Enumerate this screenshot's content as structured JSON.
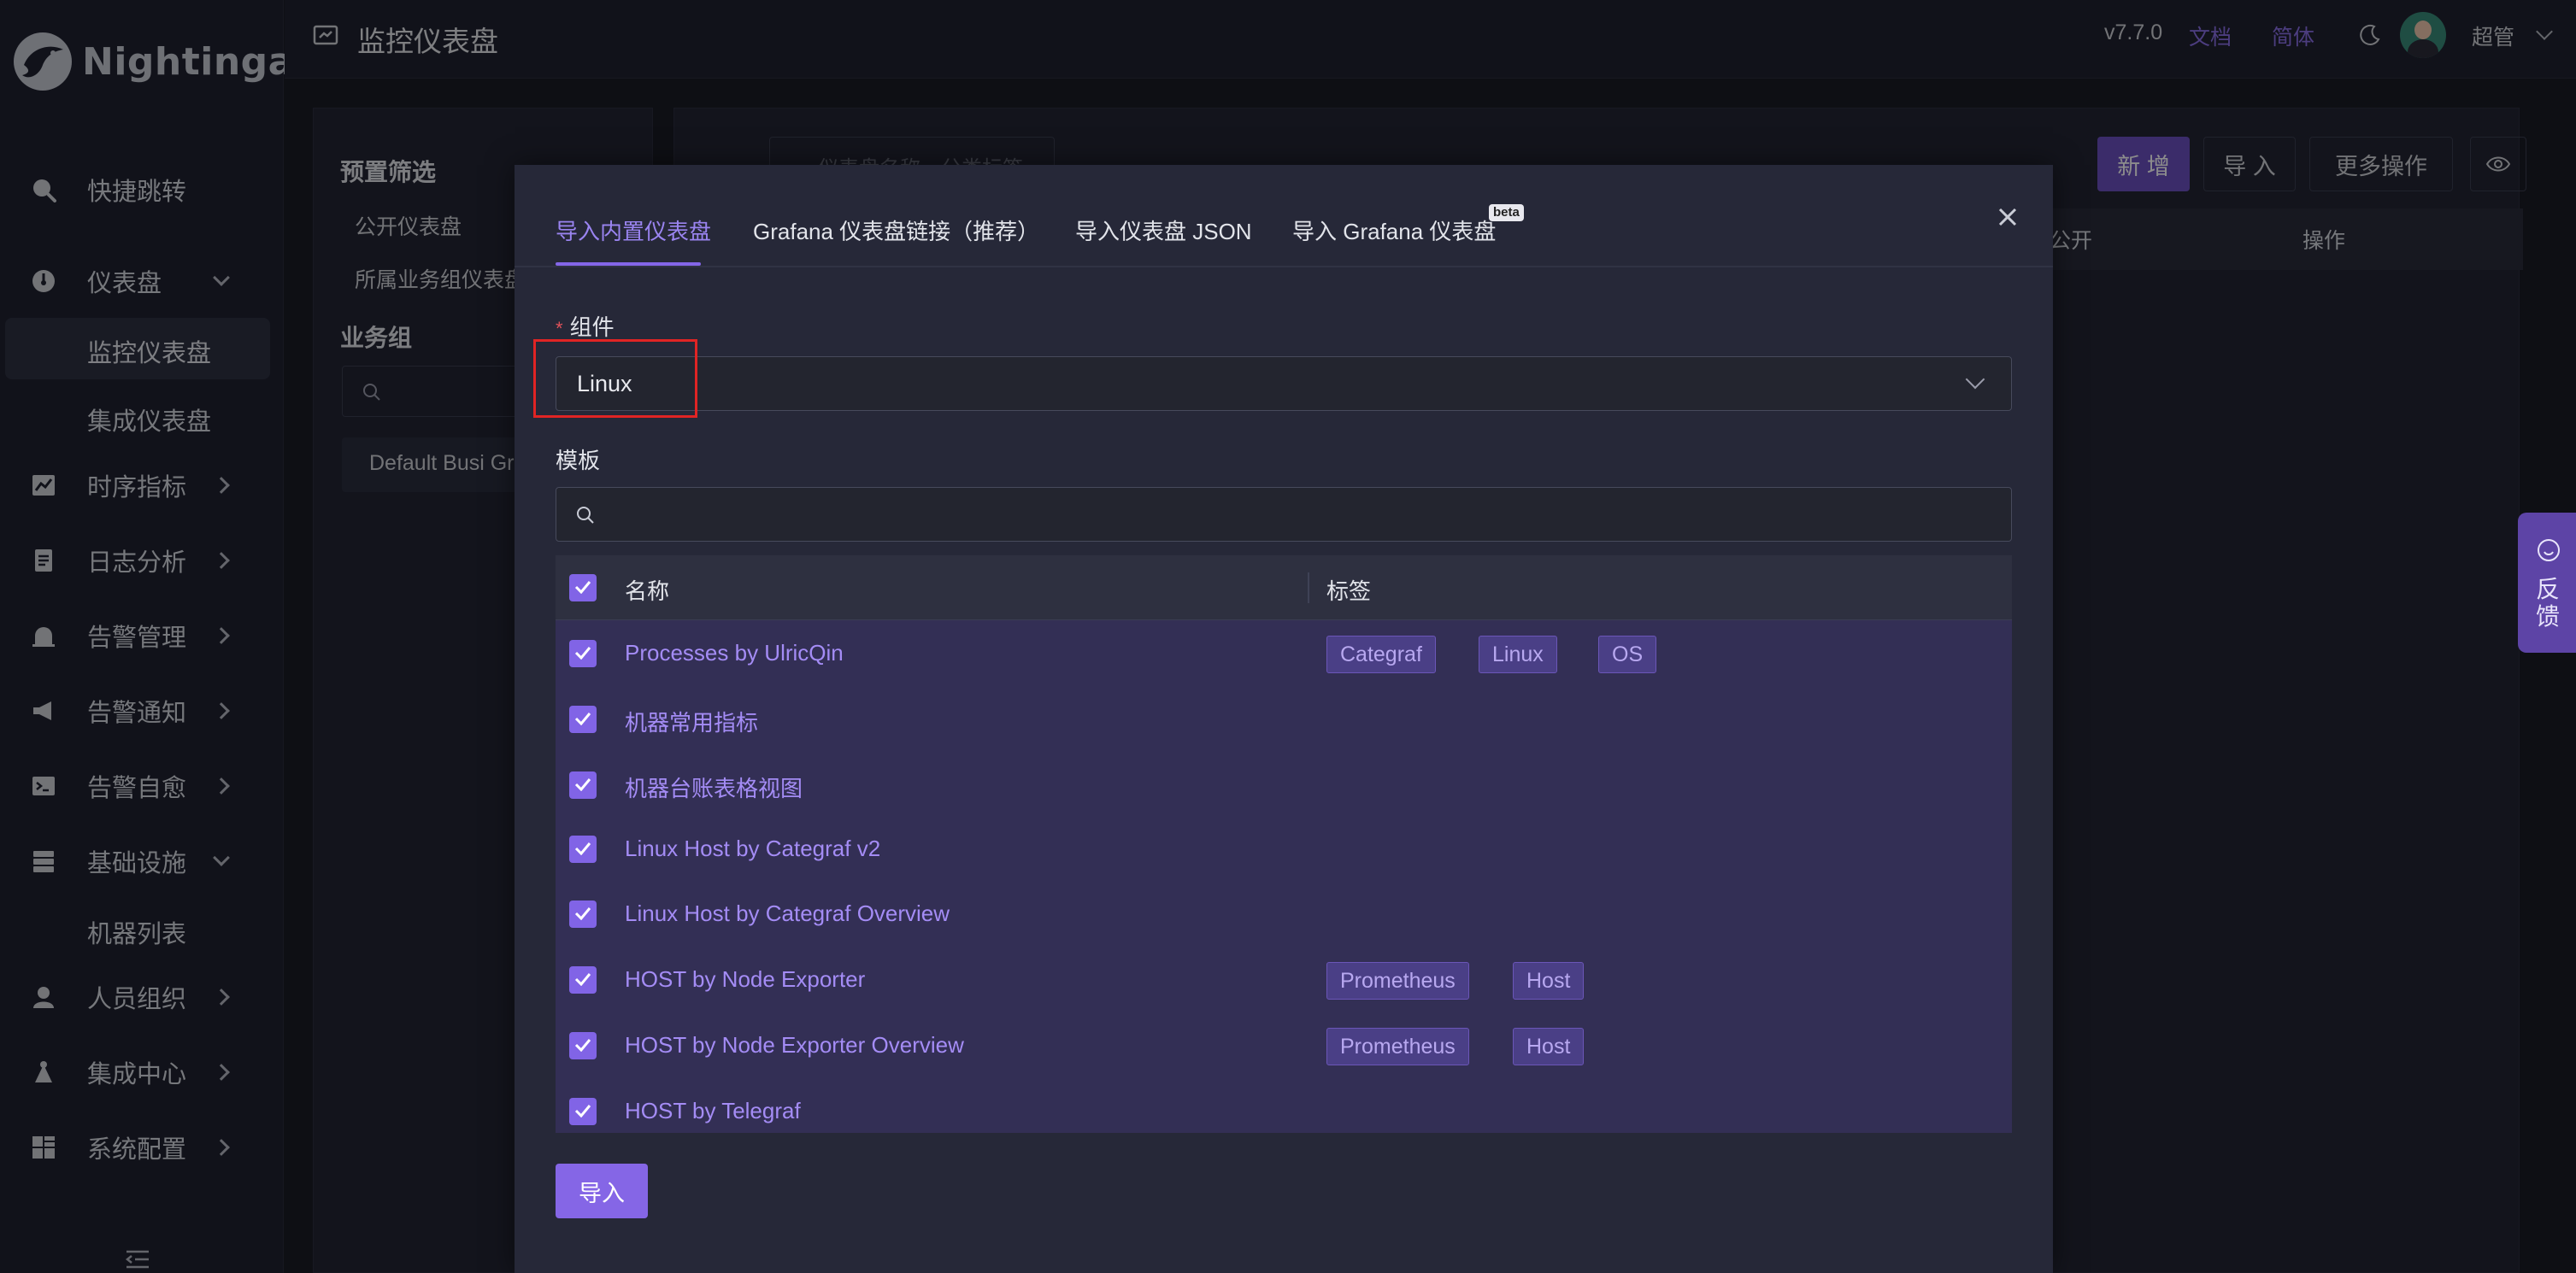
{
  "app": {
    "logo_text": "Nightingale"
  },
  "sidebar": {
    "items": [
      {
        "label": "快捷跳转",
        "icon": "search-icon"
      },
      {
        "label": "仪表盘",
        "icon": "dashboard-icon"
      },
      {
        "label": "时序指标",
        "icon": "line-chart-icon"
      },
      {
        "label": "日志分析",
        "icon": "document-icon"
      },
      {
        "label": "告警管理",
        "icon": "alarm-icon"
      },
      {
        "label": "告警通知",
        "icon": "megaphone-icon"
      },
      {
        "label": "告警自愈",
        "icon": "terminal-icon"
      },
      {
        "label": "基础设施",
        "icon": "database-icon"
      },
      {
        "label": "人员组织",
        "icon": "user-icon"
      },
      {
        "label": "集成中心",
        "icon": "integration-icon"
      },
      {
        "label": "系统配置",
        "icon": "settings-grid-icon"
      }
    ],
    "sub_dashboard": [
      "监控仪表盘",
      "集成仪表盘"
    ],
    "sub_infra": [
      "机器列表"
    ]
  },
  "header": {
    "title": "监控仪表盘",
    "version": "v7.7.0",
    "docs": "文档",
    "lang": "简体",
    "user": "超管"
  },
  "background": {
    "preset_title": "预置筛选",
    "preset_items": [
      "公开仪表盘",
      "所属业务组仪表盘"
    ],
    "bizgroup_title": "业务组",
    "bizgroup_item": "Default Busi Gr",
    "search_placeholder": "仪表盘名称、分类标签",
    "btn_new": "新 增",
    "btn_import": "导 入",
    "btn_more": "更多操作",
    "col_public": "公开",
    "col_ops": "操作"
  },
  "modal": {
    "tabs": [
      "导入内置仪表盘",
      "Grafana 仪表盘链接（推荐）",
      "导入仪表盘 JSON",
      "导入 Grafana 仪表盘"
    ],
    "beta": "beta",
    "component_label": "组件",
    "required_mark": "*",
    "component_value": "Linux",
    "template_label": "模板",
    "table_headers": {
      "name": "名称",
      "tags": "标签"
    },
    "rows": [
      {
        "name": "Processes by UlricQin",
        "tags": [
          "Categraf",
          "Linux",
          "OS"
        ]
      },
      {
        "name": "机器常用指标",
        "tags": []
      },
      {
        "name": "机器台账表格视图",
        "tags": []
      },
      {
        "name": "Linux Host by Categraf v2",
        "tags": []
      },
      {
        "name": "Linux Host by Categraf Overview",
        "tags": []
      },
      {
        "name": "HOST by Node Exporter",
        "tags": [
          "Prometheus",
          "Host"
        ]
      },
      {
        "name": "HOST by Node Exporter Overview",
        "tags": [
          "Prometheus",
          "Host"
        ]
      },
      {
        "name": "HOST by Telegraf",
        "tags": []
      }
    ],
    "import_button": "导入"
  },
  "feedback": {
    "label": "反馈"
  },
  "colors": {
    "accent": "#8466e8",
    "bg": "#1b1d26",
    "highlight": "#e02424"
  }
}
